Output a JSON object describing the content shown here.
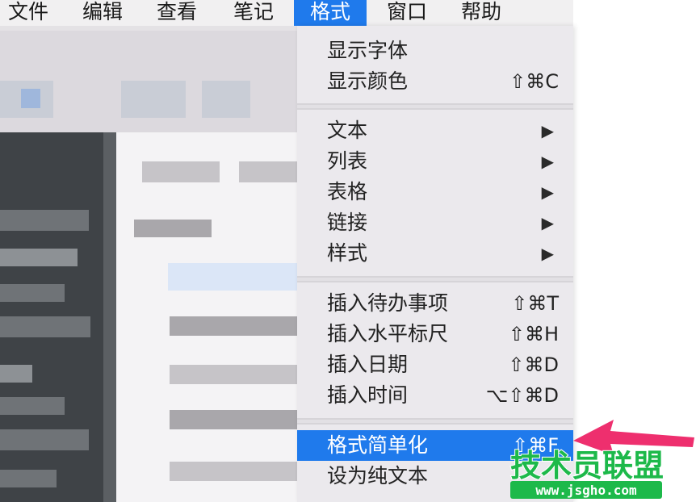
{
  "menubar": {
    "items": [
      {
        "label": "文件"
      },
      {
        "label": "编辑"
      },
      {
        "label": "查看"
      },
      {
        "label": "笔记"
      },
      {
        "label": "格式",
        "active": true
      },
      {
        "label": "窗口"
      },
      {
        "label": "帮助"
      }
    ]
  },
  "format_menu": {
    "group1": [
      {
        "label": "显示字体",
        "shortcut": ""
      },
      {
        "label": "显示颜色",
        "shortcut": "⇧⌘C"
      }
    ],
    "group2": [
      {
        "label": "文本",
        "submenu": "▶"
      },
      {
        "label": "列表",
        "submenu": "▶"
      },
      {
        "label": "表格",
        "submenu": "▶"
      },
      {
        "label": "链接",
        "submenu": "▶"
      },
      {
        "label": "样式",
        "submenu": "▶"
      }
    ],
    "group3": [
      {
        "label": "插入待办事项",
        "shortcut": "⇧⌘T"
      },
      {
        "label": "插入水平标尺",
        "shortcut": "⇧⌘H"
      },
      {
        "label": "插入日期",
        "shortcut": "⇧⌘D"
      },
      {
        "label": "插入时间",
        "shortcut": "⌥⇧⌘D"
      }
    ],
    "group4": [
      {
        "label": "格式简单化",
        "shortcut": "⇧⌘F",
        "highlighted": true
      },
      {
        "label": "设为纯文本",
        "shortcut": ""
      }
    ]
  },
  "watermark": {
    "title": "技术员联盟",
    "url": "www.jsgho.com"
  },
  "colors": {
    "accent": "#1f7aec",
    "watermark_green": "#1db94a",
    "arrow_pink": "#ee2f6e"
  }
}
